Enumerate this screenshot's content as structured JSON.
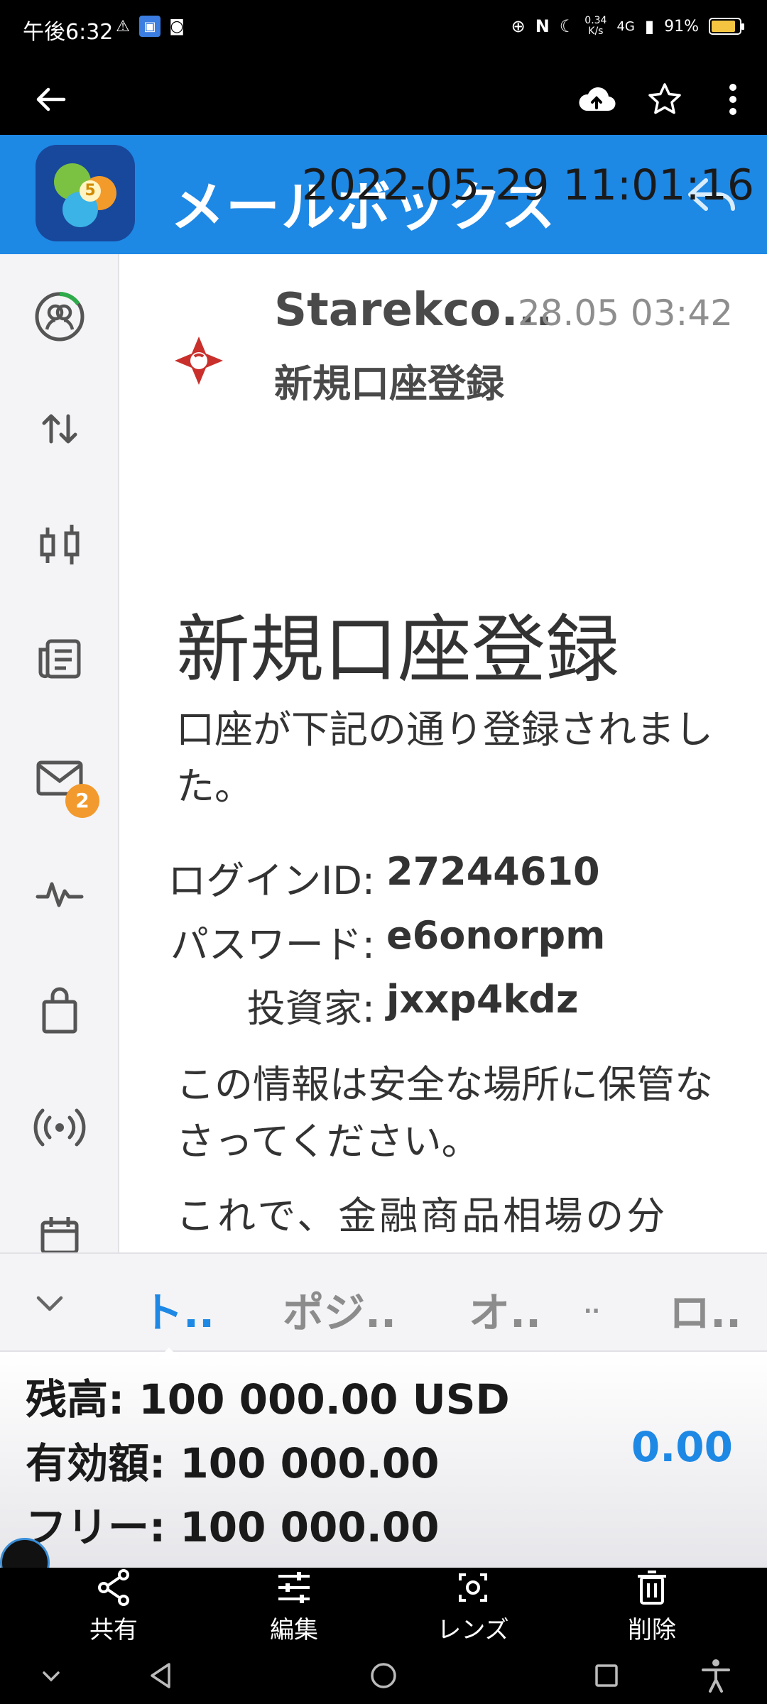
{
  "status_bar": {
    "time": "午後6:32",
    "net_speed": "0.34",
    "net_speed_unit": "K/s",
    "network": "4G",
    "battery": "91%"
  },
  "app_header": {
    "title": "メールボックス"
  },
  "sidebar": {
    "mail_badge": "2"
  },
  "message": {
    "sender": "Starekco...",
    "date": "28.05 03:42",
    "subject": "新規口座登録",
    "body_title": "新規口座登録",
    "body_intro": "口座が下記の通り登録されました。",
    "credentials": [
      {
        "label": "ログインID:",
        "value": "27244610"
      },
      {
        "label": "パスワード:",
        "value": "e6onorpm"
      },
      {
        "label": "投資家:",
        "value": "jxxp4kdz"
      }
    ],
    "body_notice": "この情報は安全な場所に保管なさってください。",
    "body_more": "これで、金融商品相場の分"
  },
  "tabs": [
    {
      "label": "ト..",
      "active": true
    },
    {
      "label": "ポジ..",
      "active": false
    },
    {
      "label": "オ..",
      "active": false
    },
    {
      "label": "..",
      "active": false
    },
    {
      "label": "ロ..",
      "active": false
    }
  ],
  "summary": {
    "balance": "残高: 100 000.00 USD",
    "equity": "有効額: 100 000.00",
    "free": "フリー: 100 000.00",
    "profit": "0.00"
  },
  "timestamp": "2022-05-29 11:01:16",
  "actions": {
    "share": "共有",
    "edit": "編集",
    "lens": "レンズ",
    "delete": "削除"
  },
  "colors": {
    "accent": "#1e88e5",
    "badge": "#f29a2e"
  }
}
